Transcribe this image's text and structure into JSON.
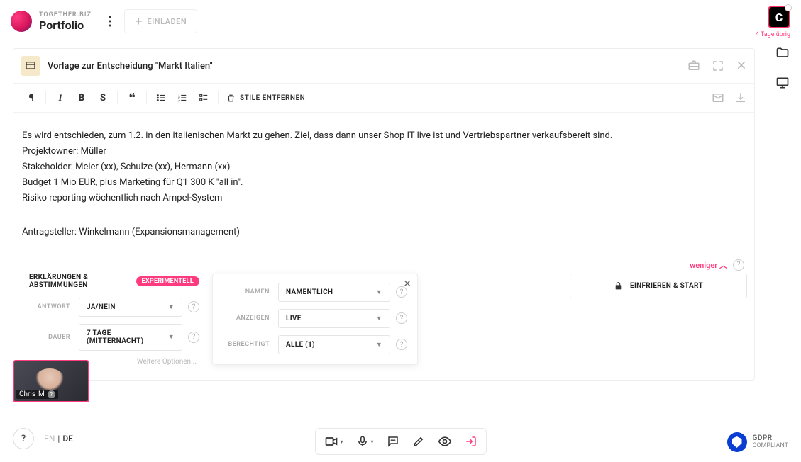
{
  "header": {
    "brand": "TOGETHER.BIZ",
    "section": "Portfolio",
    "invite_label": "EINLADEN",
    "avatar_letter": "C",
    "trial_text": "4 Tage übrig"
  },
  "card": {
    "title": "Vorlage zur Entscheidung \"Markt Italien\"",
    "remove_styles_label": "STILE ENTFERNEN"
  },
  "content": {
    "line1": "Es wird entschieden, zum 1.2. in den italienischen Markt zu gehen. Ziel, dass dann unser Shop IT live ist und Vertriebspartner verkaufsbereit sind.",
    "line2": "Projektowner: Müller",
    "line3": "Stakeholder: Meier (xx), Schulze (xx), Hermann (xx)",
    "line4": "Budget 1 Mio EUR, plus Marketing für Q1 300 K \"all in\".",
    "line5": "Risiko reporting wöchentlich nach Ampel-System",
    "line6": "Antragsteller: Winkelmann (Expansionsmanagement)"
  },
  "voting": {
    "less_label": "weniger",
    "heading": "ERKLÄRUNGEN & ABSTIMMUNGEN",
    "experimental": "EXPERIMENTELL",
    "answer_label": "ANTWORT",
    "answer_value": "JA/NEIN",
    "duration_label": "DAUER",
    "duration_value": "7 TAGE (MITTERNACHT)",
    "more_options": "Weitere Optionen...",
    "names_label": "NAMEN",
    "names_value": "NAMENTLICH",
    "show_label": "ANZEIGEN",
    "show_value": "LIVE",
    "eligible_label": "BERECHTIGT",
    "eligible_value": "ALLE (1)",
    "freeze_label": "EINFRIEREN & START"
  },
  "video": {
    "name": "Chris",
    "initial": "M"
  },
  "bottom": {
    "lang_en": "EN",
    "lang_de": "DE"
  },
  "gdpr": {
    "title": "GDPR",
    "sub": "COMPLIANT"
  }
}
